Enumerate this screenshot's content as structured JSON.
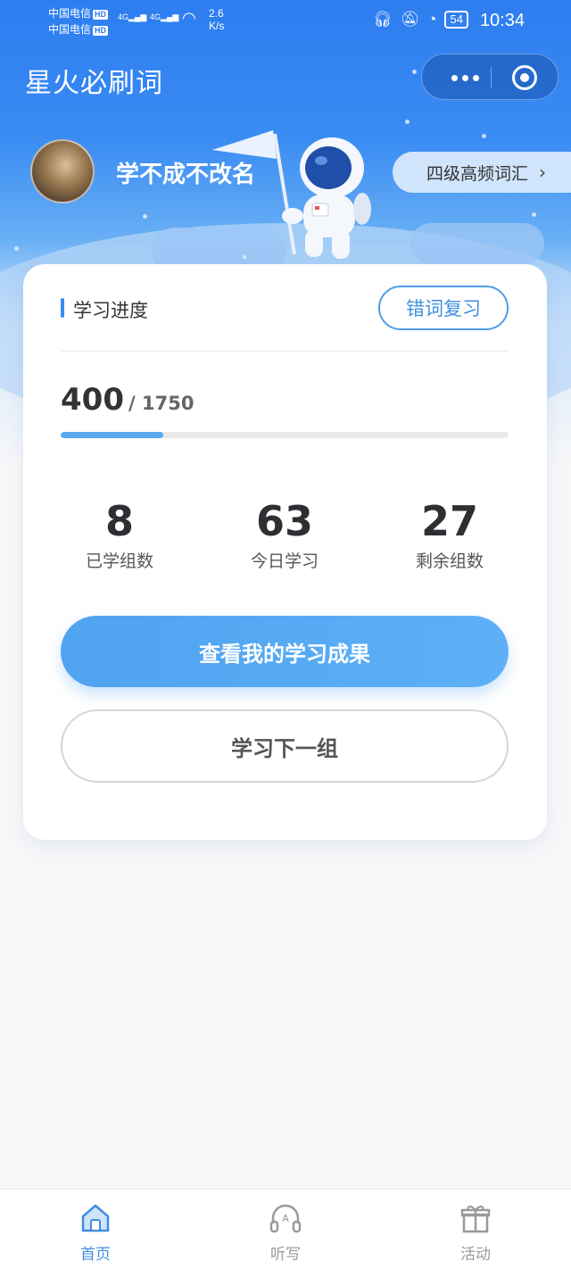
{
  "status_bar": {
    "carrier1": "中国电信",
    "carrier2": "中国电信",
    "hd": "HD",
    "sig1": "4G",
    "sig2": "4G",
    "speed_value": "2.6",
    "speed_unit": "K/s",
    "battery": "54",
    "time": "10:34"
  },
  "header": {
    "app_title": "星火必刷词"
  },
  "profile": {
    "username": "学不成不改名",
    "vocab_book": "四级高频词汇"
  },
  "progress_card": {
    "section_title": "学习进度",
    "review_button": "错词复习",
    "learned": "400",
    "total": "/ 1750",
    "progress_fraction": 0.2286,
    "stats": [
      {
        "value": "8",
        "label": "已学组数"
      },
      {
        "value": "63",
        "label": "今日学习"
      },
      {
        "value": "27",
        "label": "剩余组数"
      }
    ],
    "primary_button": "查看我的学习成果",
    "secondary_button": "学习下一组"
  },
  "tabbar": {
    "items": [
      {
        "label": "首页",
        "icon": "home-icon",
        "active": true
      },
      {
        "label": "听写",
        "icon": "headphones-icon",
        "active": false
      },
      {
        "label": "活动",
        "icon": "gift-icon",
        "active": false
      }
    ]
  },
  "colors": {
    "brand_blue": "#3a8cf3",
    "button_blue": "#4fa3f0",
    "active_tab": "#3f8ee0"
  }
}
